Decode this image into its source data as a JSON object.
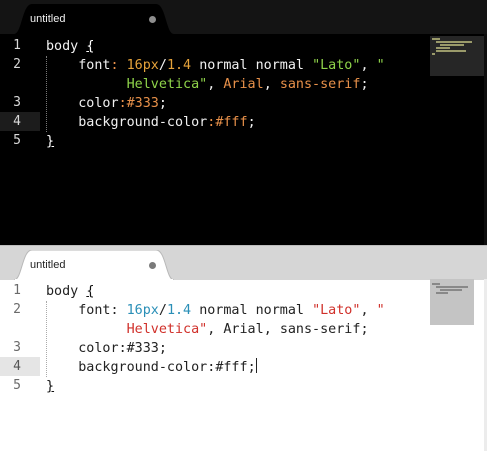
{
  "tab_title": "untitled",
  "line_numbers": [
    "1",
    "2",
    "3",
    "4",
    "5"
  ],
  "code": {
    "l1_sel": "body",
    "l1_brace": "{",
    "l2_prop": "font",
    "l2_colon": ":",
    "l2_size": "16px",
    "l2_slash": "/",
    "l2_lh": "1.4",
    "l2_normal1": "normal",
    "l2_normal2": "normal",
    "l2_lato": "\"Lato\"",
    "l2_comma1": ",",
    "l2_quote": "\"",
    "l2b_helv": "Helvetica\"",
    "l2b_comma2": ",",
    "l2b_arial": "Arial",
    "l2b_comma3": ",",
    "l2b_sans": "sans-serif",
    "l2b_semi": ";",
    "l3_prop": "color",
    "l3_colon": ":",
    "l3_val": "#333",
    "l3_semi": ";",
    "l4_prop": "background-color",
    "l4_colon": ":",
    "l4_val": "#fff",
    "l4_semi": ";",
    "l5_brace": "}"
  },
  "themes": {
    "top": "dark",
    "bottom": "light"
  }
}
